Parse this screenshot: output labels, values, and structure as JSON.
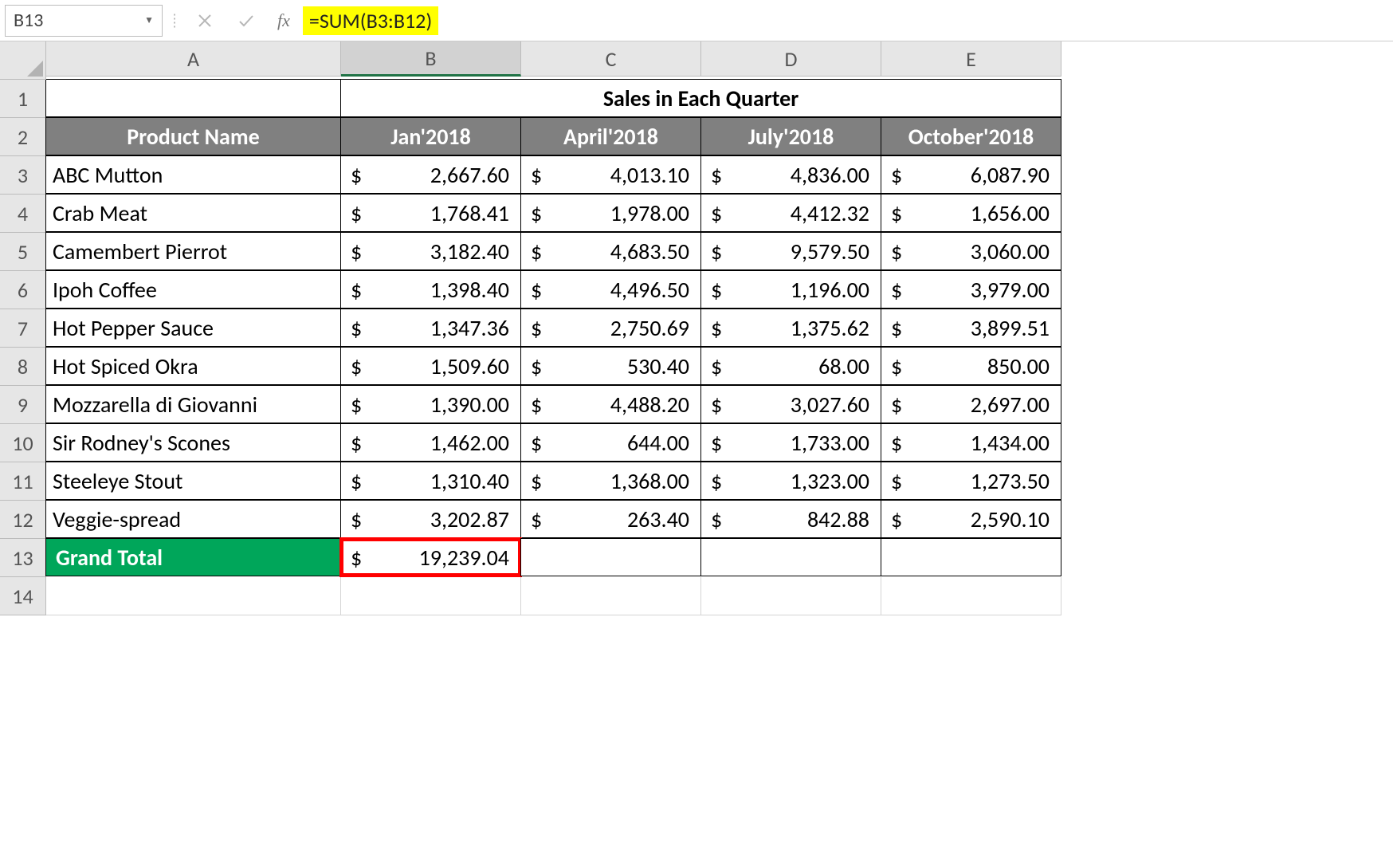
{
  "name_box": "B13",
  "formula": "=SUM(B3:B12)",
  "fx_label": "fx",
  "col_headers": [
    "A",
    "B",
    "C",
    "D",
    "E"
  ],
  "row_headers": [
    "1",
    "2",
    "3",
    "4",
    "5",
    "6",
    "7",
    "8",
    "9",
    "10",
    "11",
    "12",
    "13",
    "14"
  ],
  "title_merged": "Sales in Each Quarter",
  "headers": {
    "product": "Product Name",
    "q1": "Jan'2018",
    "q2": "April'2018",
    "q3": "July'2018",
    "q4": "October'2018"
  },
  "rows": [
    {
      "name": "ABC Mutton",
      "q1": "2,667.60",
      "q2": "4,013.10",
      "q3": "4,836.00",
      "q4": "6,087.90"
    },
    {
      "name": "Crab Meat",
      "q1": "1,768.41",
      "q2": "1,978.00",
      "q3": "4,412.32",
      "q4": "1,656.00"
    },
    {
      "name": "Camembert Pierrot",
      "q1": "3,182.40",
      "q2": "4,683.50",
      "q3": "9,579.50",
      "q4": "3,060.00"
    },
    {
      "name": "Ipoh Coffee",
      "q1": "1,398.40",
      "q2": "4,496.50",
      "q3": "1,196.00",
      "q4": "3,979.00"
    },
    {
      "name": "Hot Pepper Sauce",
      "q1": "1,347.36",
      "q2": "2,750.69",
      "q3": "1,375.62",
      "q4": "3,899.51"
    },
    {
      "name": " Hot Spiced Okra",
      "q1": "1,509.60",
      "q2": "530.40",
      "q3": "68.00",
      "q4": "850.00"
    },
    {
      "name": "Mozzarella di Giovanni",
      "q1": "1,390.00",
      "q2": "4,488.20",
      "q3": "3,027.60",
      "q4": "2,697.00"
    },
    {
      "name": "Sir Rodney's Scones",
      "q1": "1,462.00",
      "q2": "644.00",
      "q3": "1,733.00",
      "q4": "1,434.00"
    },
    {
      "name": "Steeleye Stout",
      "q1": "1,310.40",
      "q2": "1,368.00",
      "q3": "1,323.00",
      "q4": "1,273.50"
    },
    {
      "name": "Veggie-spread",
      "q1": "3,202.87",
      "q2": "263.40",
      "q3": "842.88",
      "q4": "2,590.10"
    }
  ],
  "grand_total_label": "Grand Total",
  "grand_total_value": "19,239.04",
  "currency": "$",
  "selected_cell": "B13",
  "chart_data": {
    "type": "table",
    "title": "Sales in Each Quarter",
    "columns": [
      "Product Name",
      "Jan'2018",
      "April'2018",
      "July'2018",
      "October'2018"
    ],
    "rows": [
      [
        "ABC Mutton",
        2667.6,
        4013.1,
        4836.0,
        6087.9
      ],
      [
        "Crab Meat",
        1768.41,
        1978.0,
        4412.32,
        1656.0
      ],
      [
        "Camembert Pierrot",
        3182.4,
        4683.5,
        9579.5,
        3060.0
      ],
      [
        "Ipoh Coffee",
        1398.4,
        4496.5,
        1196.0,
        3979.0
      ],
      [
        "Hot Pepper Sauce",
        1347.36,
        2750.69,
        1375.62,
        3899.51
      ],
      [
        "Hot Spiced Okra",
        1509.6,
        530.4,
        68.0,
        850.0
      ],
      [
        "Mozzarella di Giovanni",
        1390.0,
        4488.2,
        3027.6,
        2697.0
      ],
      [
        "Sir Rodney's Scones",
        1462.0,
        644.0,
        1733.0,
        1434.0
      ],
      [
        "Steeleye Stout",
        1310.4,
        1368.0,
        1323.0,
        1273.5
      ],
      [
        "Veggie-spread",
        3202.87,
        263.4,
        842.88,
        2590.1
      ]
    ],
    "totals": {
      "Jan'2018": 19239.04
    }
  }
}
